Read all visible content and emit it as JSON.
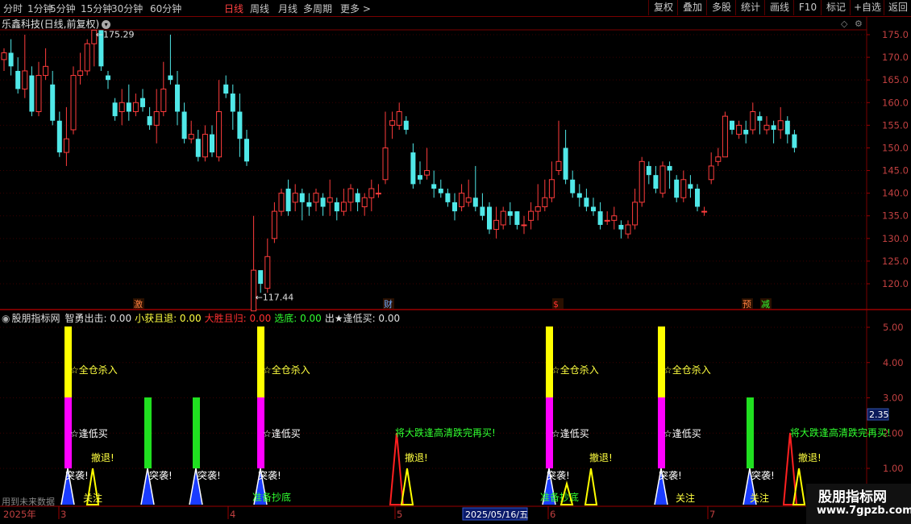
{
  "toolbar": {
    "timeframes": [
      {
        "label": "分时",
        "active": false
      },
      {
        "label": "1分钟",
        "active": false
      },
      {
        "label": "5分钟",
        "active": false
      },
      {
        "label": "15分钟",
        "active": false
      },
      {
        "label": "30分钟",
        "active": false
      },
      {
        "label": "60分钟",
        "active": false
      },
      {
        "label": "日线",
        "active": true
      },
      {
        "label": "周线",
        "active": false
      },
      {
        "label": "月线",
        "active": false
      },
      {
        "label": "多周期",
        "active": false
      },
      {
        "label": "更多 >",
        "active": false
      }
    ],
    "right_buttons": [
      "复权",
      "叠加",
      "多股",
      "统计",
      "画线",
      "F10",
      "标记",
      "+自选",
      "返回"
    ]
  },
  "chart": {
    "title": "乐鑫科技(日线,前复权)",
    "high_label": "175.29",
    "low_label": "117.44",
    "price_axis": [
      "175.0",
      "170.0",
      "165.0",
      "160.0",
      "155.0",
      "150.0",
      "145.0",
      "140.0",
      "135.0",
      "130.0",
      "125.0",
      "120.0"
    ],
    "event_markers": [
      {
        "text": "激",
        "color": "#ff8040"
      },
      {
        "text": "财",
        "color": "#6fa8ff"
      },
      {
        "text": "$",
        "color": "#ff3030"
      },
      {
        "text": "预",
        "color": "#ff8040"
      },
      {
        "text": "减",
        "color": "#30ff30"
      }
    ]
  },
  "indicator": {
    "name": "股朋指标网",
    "values": [
      {
        "label": "智勇出击: 0.00",
        "color": "#e0e0e0"
      },
      {
        "label": "小获且退: 0.00",
        "color": "#ffff40"
      },
      {
        "label": "大胜且归: 0.00",
        "color": "#ff3030"
      },
      {
        "label": "选底: 0.00",
        "color": "#30ff30"
      },
      {
        "label": "出★逢低买: 0.00",
        "color": "#e0e0e0"
      }
    ],
    "axis": [
      "5.00",
      "4.00",
      "3.00",
      "2.00",
      "1.00"
    ],
    "current_value": "2.35",
    "labels": {
      "quancang": "☆全仓杀入",
      "fengdimai": "☆逢低买",
      "tuxi": "突袭!",
      "chetui": "撤退!",
      "guanzhu": "关注",
      "chaodi": "准备抄底",
      "dadie": "将大跌逢高清跌完再买!"
    }
  },
  "date_axis": {
    "year": "2025年",
    "months": [
      "3",
      "4",
      "5",
      "6",
      "7"
    ],
    "highlight": "2025/05/16/五"
  },
  "footer": {
    "hint": "用到未来数据",
    "site_name": "股朋指标网",
    "site_url": "www.7gpzb.com"
  },
  "chart_data": {
    "type": "candlestick",
    "title": "乐鑫科技(日线,前复权)",
    "y_unit": "price",
    "ylim": [
      117,
      178
    ],
    "annotations": {
      "high": 175.29,
      "low": 117.44
    },
    "candles": [
      [
        169.5,
        171,
        172,
        167
      ],
      [
        171,
        168,
        174,
        166
      ],
      [
        167,
        163,
        170,
        162
      ],
      [
        163,
        167,
        175,
        161
      ],
      [
        166,
        158,
        168,
        157
      ],
      [
        158,
        166,
        169,
        157
      ],
      [
        166,
        168,
        172,
        165
      ],
      [
        164,
        156,
        167,
        155
      ],
      [
        156,
        149,
        158,
        148
      ],
      [
        149,
        152,
        159,
        146
      ],
      [
        154,
        166,
        168,
        153
      ],
      [
        166,
        167,
        171,
        164
      ],
      [
        167,
        173,
        174,
        166
      ],
      [
        173,
        176,
        176,
        168
      ],
      [
        176,
        168,
        176,
        167
      ],
      [
        166,
        165,
        167,
        163
      ],
      [
        160,
        157,
        161,
        156
      ],
      [
        158,
        160,
        163,
        155
      ],
      [
        160,
        158,
        164,
        156
      ],
      [
        158,
        160,
        162,
        157
      ],
      [
        161,
        159,
        163,
        158
      ],
      [
        157,
        155,
        159,
        154
      ],
      [
        155,
        158,
        163,
        151
      ],
      [
        158,
        163,
        169,
        157
      ],
      [
        166,
        165,
        175,
        164
      ],
      [
        164,
        158,
        167,
        155
      ],
      [
        158,
        152,
        160,
        151
      ],
      [
        152,
        153,
        156,
        151
      ],
      [
        152,
        148,
        154,
        147
      ],
      [
        148,
        153,
        155,
        147
      ],
      [
        153,
        149,
        155,
        148
      ],
      [
        148,
        158,
        165,
        147
      ],
      [
        164,
        162,
        166,
        161
      ],
      [
        162,
        158,
        164,
        154
      ],
      [
        158,
        152,
        162,
        148
      ],
      [
        152,
        147,
        154,
        146
      ],
      [
        114,
        123,
        135,
        117.44
      ],
      [
        123,
        120,
        122,
        118
      ],
      [
        119,
        126,
        130,
        118
      ],
      [
        130,
        136,
        138,
        129
      ],
      [
        136,
        140,
        141,
        135
      ],
      [
        141,
        136,
        143,
        135
      ],
      [
        138,
        140,
        142,
        136
      ],
      [
        140,
        138,
        141,
        134
      ],
      [
        138,
        137,
        140,
        135
      ],
      [
        138,
        140,
        141,
        136
      ],
      [
        139,
        137,
        140,
        135
      ],
      [
        138,
        139,
        143,
        135
      ],
      [
        138,
        136,
        139,
        134
      ],
      [
        136,
        138,
        141,
        135
      ],
      [
        138,
        141,
        142,
        136
      ],
      [
        140,
        138,
        141,
        136
      ],
      [
        137,
        139,
        140,
        135
      ],
      [
        139,
        141,
        143,
        136
      ],
      [
        140,
        140,
        142,
        139
      ],
      [
        143,
        150,
        158,
        142
      ],
      [
        155,
        156,
        158,
        152
      ],
      [
        155,
        158,
        160,
        154
      ],
      [
        156,
        154,
        157,
        153
      ],
      [
        149,
        142,
        151,
        141
      ],
      [
        144,
        143,
        147,
        142
      ],
      [
        144,
        145,
        150,
        143
      ],
      [
        142,
        141,
        145,
        139
      ],
      [
        141,
        140,
        143,
        139
      ],
      [
        140,
        138,
        141,
        137
      ],
      [
        138,
        136,
        140,
        134
      ],
      [
        137,
        140,
        142,
        136
      ],
      [
        138,
        139,
        143,
        137
      ],
      [
        139,
        137,
        146,
        136
      ],
      [
        137,
        135,
        140,
        134
      ],
      [
        137,
        132,
        138,
        131
      ],
      [
        132,
        134,
        137,
        130
      ],
      [
        133,
        136,
        137,
        132
      ],
      [
        136,
        135,
        138,
        133
      ],
      [
        136,
        133,
        136,
        132
      ],
      [
        133,
        133,
        135,
        131
      ],
      [
        134,
        136,
        138,
        132
      ],
      [
        136,
        137,
        142,
        134
      ],
      [
        137,
        139,
        143,
        136
      ],
      [
        139,
        143,
        147,
        138
      ],
      [
        145,
        147,
        156,
        144
      ],
      [
        150,
        143,
        154,
        142
      ],
      [
        143,
        140,
        145,
        139
      ],
      [
        140,
        139,
        142,
        137
      ],
      [
        139,
        137,
        141,
        136
      ],
      [
        137,
        136,
        139,
        135
      ],
      [
        136,
        133,
        138,
        132
      ],
      [
        134,
        134,
        136,
        133
      ],
      [
        134,
        135,
        137,
        132
      ],
      [
        133,
        132,
        134,
        130
      ],
      [
        131,
        133,
        134,
        130
      ],
      [
        133,
        138,
        141,
        132
      ],
      [
        138,
        147,
        148,
        137
      ],
      [
        146,
        144,
        147,
        142
      ],
      [
        144,
        141,
        146,
        140
      ],
      [
        140,
        146,
        147,
        139
      ],
      [
        146,
        145,
        147,
        141
      ],
      [
        143,
        139,
        144,
        138
      ],
      [
        139,
        143,
        145,
        138
      ],
      [
        142,
        141,
        144,
        139
      ],
      [
        141,
        137,
        142,
        136
      ],
      [
        136,
        136,
        137,
        135
      ],
      [
        143,
        146,
        149,
        142
      ],
      [
        147,
        148,
        150,
        146
      ],
      [
        148,
        157,
        158,
        148
      ],
      [
        156,
        154,
        156,
        153
      ],
      [
        153,
        155,
        156,
        152
      ],
      [
        154,
        153,
        156,
        151
      ],
      [
        154,
        158,
        160,
        153
      ],
      [
        157,
        156,
        158,
        153
      ],
      [
        154,
        155,
        157,
        153
      ],
      [
        155,
        154,
        156,
        151
      ],
      [
        154,
        156,
        159,
        152
      ],
      [
        156,
        153,
        157,
        151
      ],
      [
        153,
        150,
        154,
        149
      ]
    ]
  }
}
